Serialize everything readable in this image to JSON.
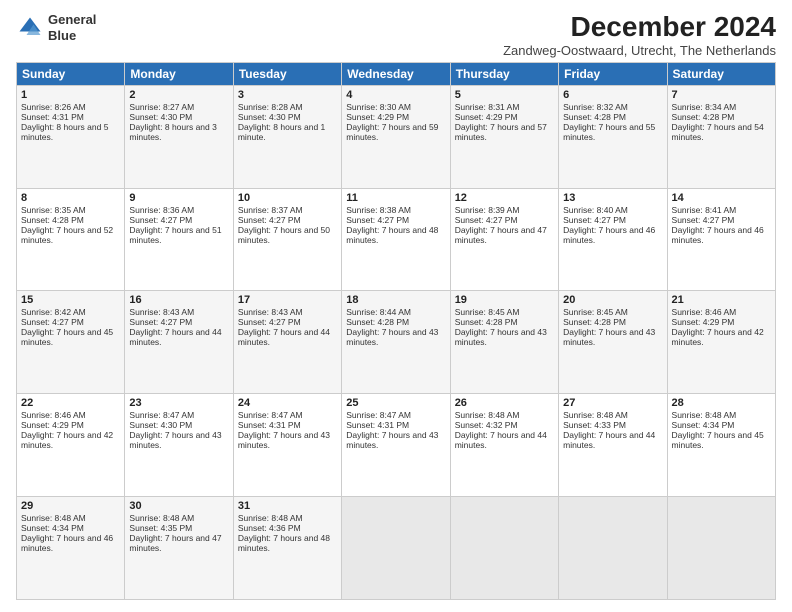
{
  "logo": {
    "line1": "General",
    "line2": "Blue"
  },
  "title": "December 2024",
  "subtitle": "Zandweg-Oostwaard, Utrecht, The Netherlands",
  "headers": [
    "Sunday",
    "Monday",
    "Tuesday",
    "Wednesday",
    "Thursday",
    "Friday",
    "Saturday"
  ],
  "weeks": [
    [
      {
        "day": "1",
        "info": "Sunrise: 8:26 AM\nSunset: 4:31 PM\nDaylight: 8 hours and 5 minutes."
      },
      {
        "day": "2",
        "info": "Sunrise: 8:27 AM\nSunset: 4:30 PM\nDaylight: 8 hours and 3 minutes."
      },
      {
        "day": "3",
        "info": "Sunrise: 8:28 AM\nSunset: 4:30 PM\nDaylight: 8 hours and 1 minute."
      },
      {
        "day": "4",
        "info": "Sunrise: 8:30 AM\nSunset: 4:29 PM\nDaylight: 7 hours and 59 minutes."
      },
      {
        "day": "5",
        "info": "Sunrise: 8:31 AM\nSunset: 4:29 PM\nDaylight: 7 hours and 57 minutes."
      },
      {
        "day": "6",
        "info": "Sunrise: 8:32 AM\nSunset: 4:28 PM\nDaylight: 7 hours and 55 minutes."
      },
      {
        "day": "7",
        "info": "Sunrise: 8:34 AM\nSunset: 4:28 PM\nDaylight: 7 hours and 54 minutes."
      }
    ],
    [
      {
        "day": "8",
        "info": "Sunrise: 8:35 AM\nSunset: 4:28 PM\nDaylight: 7 hours and 52 minutes."
      },
      {
        "day": "9",
        "info": "Sunrise: 8:36 AM\nSunset: 4:27 PM\nDaylight: 7 hours and 51 minutes."
      },
      {
        "day": "10",
        "info": "Sunrise: 8:37 AM\nSunset: 4:27 PM\nDaylight: 7 hours and 50 minutes."
      },
      {
        "day": "11",
        "info": "Sunrise: 8:38 AM\nSunset: 4:27 PM\nDaylight: 7 hours and 48 minutes."
      },
      {
        "day": "12",
        "info": "Sunrise: 8:39 AM\nSunset: 4:27 PM\nDaylight: 7 hours and 47 minutes."
      },
      {
        "day": "13",
        "info": "Sunrise: 8:40 AM\nSunset: 4:27 PM\nDaylight: 7 hours and 46 minutes."
      },
      {
        "day": "14",
        "info": "Sunrise: 8:41 AM\nSunset: 4:27 PM\nDaylight: 7 hours and 46 minutes."
      }
    ],
    [
      {
        "day": "15",
        "info": "Sunrise: 8:42 AM\nSunset: 4:27 PM\nDaylight: 7 hours and 45 minutes."
      },
      {
        "day": "16",
        "info": "Sunrise: 8:43 AM\nSunset: 4:27 PM\nDaylight: 7 hours and 44 minutes."
      },
      {
        "day": "17",
        "info": "Sunrise: 8:43 AM\nSunset: 4:27 PM\nDaylight: 7 hours and 44 minutes."
      },
      {
        "day": "18",
        "info": "Sunrise: 8:44 AM\nSunset: 4:28 PM\nDaylight: 7 hours and 43 minutes."
      },
      {
        "day": "19",
        "info": "Sunrise: 8:45 AM\nSunset: 4:28 PM\nDaylight: 7 hours and 43 minutes."
      },
      {
        "day": "20",
        "info": "Sunrise: 8:45 AM\nSunset: 4:28 PM\nDaylight: 7 hours and 43 minutes."
      },
      {
        "day": "21",
        "info": "Sunrise: 8:46 AM\nSunset: 4:29 PM\nDaylight: 7 hours and 42 minutes."
      }
    ],
    [
      {
        "day": "22",
        "info": "Sunrise: 8:46 AM\nSunset: 4:29 PM\nDaylight: 7 hours and 42 minutes."
      },
      {
        "day": "23",
        "info": "Sunrise: 8:47 AM\nSunset: 4:30 PM\nDaylight: 7 hours and 43 minutes."
      },
      {
        "day": "24",
        "info": "Sunrise: 8:47 AM\nSunset: 4:31 PM\nDaylight: 7 hours and 43 minutes."
      },
      {
        "day": "25",
        "info": "Sunrise: 8:47 AM\nSunset: 4:31 PM\nDaylight: 7 hours and 43 minutes."
      },
      {
        "day": "26",
        "info": "Sunrise: 8:48 AM\nSunset: 4:32 PM\nDaylight: 7 hours and 44 minutes."
      },
      {
        "day": "27",
        "info": "Sunrise: 8:48 AM\nSunset: 4:33 PM\nDaylight: 7 hours and 44 minutes."
      },
      {
        "day": "28",
        "info": "Sunrise: 8:48 AM\nSunset: 4:34 PM\nDaylight: 7 hours and 45 minutes."
      }
    ],
    [
      {
        "day": "29",
        "info": "Sunrise: 8:48 AM\nSunset: 4:34 PM\nDaylight: 7 hours and 46 minutes."
      },
      {
        "day": "30",
        "info": "Sunrise: 8:48 AM\nSunset: 4:35 PM\nDaylight: 7 hours and 47 minutes."
      },
      {
        "day": "31",
        "info": "Sunrise: 8:48 AM\nSunset: 4:36 PM\nDaylight: 7 hours and 48 minutes."
      },
      {
        "day": "",
        "info": ""
      },
      {
        "day": "",
        "info": ""
      },
      {
        "day": "",
        "info": ""
      },
      {
        "day": "",
        "info": ""
      }
    ]
  ]
}
